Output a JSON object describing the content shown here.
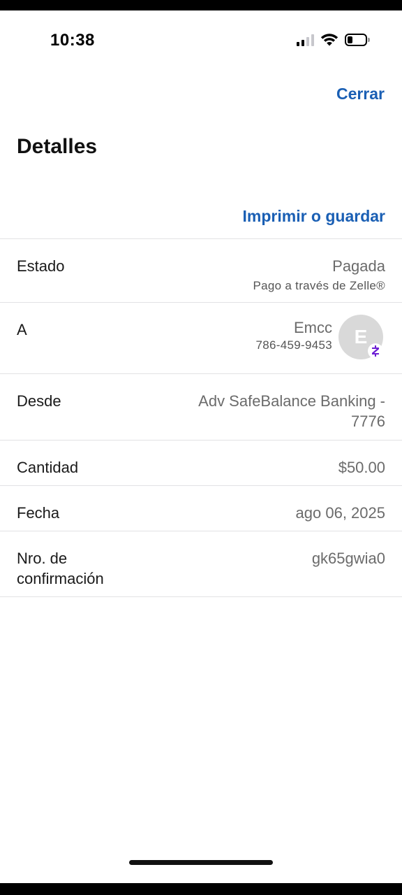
{
  "status_bar": {
    "time": "10:38",
    "icons": [
      "cellular-signal-icon",
      "wifi-icon",
      "battery-icon"
    ],
    "battery_level": 0.2
  },
  "header": {
    "close_label": "Cerrar",
    "title": "Detalles",
    "print_label": "Imprimir o guardar"
  },
  "details": {
    "status": {
      "label": "Estado",
      "value": "Pagada",
      "sub": "Pago a través de Zelle®"
    },
    "recipient": {
      "label": "A",
      "name": "Emcc",
      "phone": "786-459-9453",
      "avatar_initial": "E",
      "badge_icon": "zelle-icon"
    },
    "from": {
      "label": "Desde",
      "value_line1": "Adv SafeBalance Banking -",
      "value_line2": "7776"
    },
    "amount": {
      "label": "Cantidad",
      "value": "$50.00"
    },
    "date": {
      "label": "Fecha",
      "value": "ago 06, 2025"
    },
    "confirmation": {
      "label_line1": "Nro. de",
      "label_line2": "confirmación",
      "value": "gk65gwia0"
    }
  },
  "colors": {
    "link": "#1a5fb4",
    "zelle": "#6d1ed4",
    "divider": "#e2e2e4"
  }
}
